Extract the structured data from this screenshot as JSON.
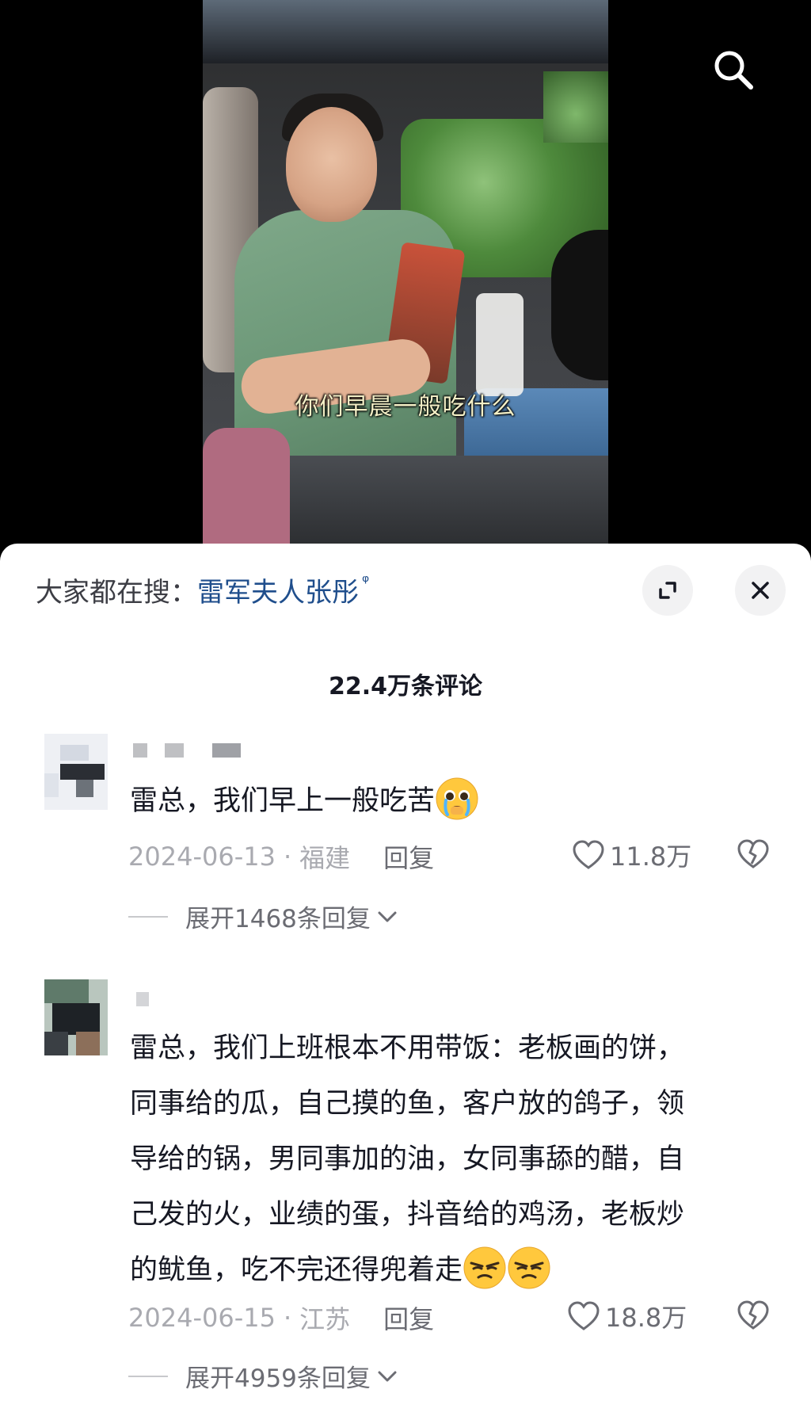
{
  "video": {
    "subtitle": "你们早晨一般吃什么"
  },
  "top_bar": {
    "search_icon": "search-icon"
  },
  "panel": {
    "hot_search_prefix": "大家都在搜：",
    "hot_search_term": "雷军夫人张彤",
    "hot_search_suffix": "ᵠ",
    "expand_icon": "collapse-arrows-icon",
    "close_icon": "close-icon",
    "comment_count": "22.4万条评论"
  },
  "comments": [
    {
      "lines": [
        "雷总，我们早上一般吃苦"
      ],
      "emoji": "pleading-crying-emoji",
      "date": "2024-06-13",
      "separator": "·",
      "location": "福建",
      "reply_label": "回复",
      "likes": "11.8万",
      "expand_label": "展开1468条回复",
      "avatar_colors": [
        "#c9d0db",
        "#2b2e34",
        "#6c7279",
        "#dfe3ea"
      ]
    },
    {
      "lines": [
        "雷总，我们上班根本不用带饭：老板画的饼，",
        "同事给的瓜，自己摸的鱼，客户放的鸽子，领",
        "导给的锅，男同事加的油，女同事舔的醋，自",
        "己发的火，业绩的蛋，抖音给的鸡汤，老板炒",
        "的鱿鱼，吃不完还得兜着走"
      ],
      "emoji": "smirk-emoji",
      "date": "2024-06-15",
      "separator": "·",
      "location": "江苏",
      "reply_label": "回复",
      "likes": "18.8万",
      "expand_label": "展开4959条回复",
      "avatar_colors": [
        "#5f7a6a",
        "#1e2226",
        "#8c6f5a",
        "#b9c6be"
      ]
    }
  ]
}
